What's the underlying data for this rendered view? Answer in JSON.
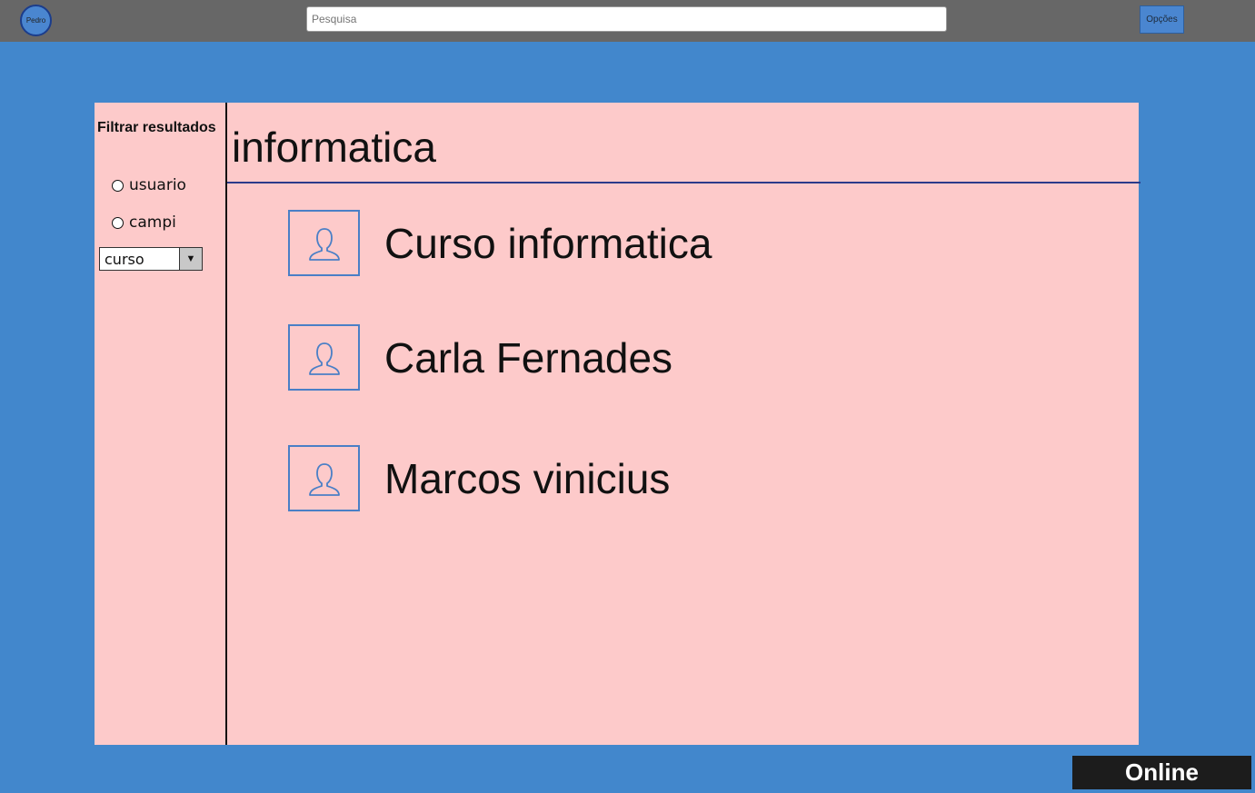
{
  "topbar": {
    "avatar_label": "Pedro",
    "search_placeholder": "Pesquisa",
    "options_label": "Opções"
  },
  "sidebar": {
    "title": "Filtrar resultados",
    "filters": [
      {
        "label": "usuario",
        "checked": false
      },
      {
        "label": "campi",
        "checked": false
      }
    ],
    "select_value": "curso"
  },
  "main": {
    "heading": "informatica",
    "results": [
      {
        "name": "Curso informatica",
        "icon": "user-icon"
      },
      {
        "name": "Carla Fernades",
        "icon": "user-icon"
      },
      {
        "name": "Marcos vinicius",
        "icon": "user-icon"
      }
    ]
  },
  "status": "Online",
  "colors": {
    "background": "#4287cc",
    "topbar": "#676767",
    "panel": "#fdcaca",
    "status_bg": "#1c1c1c"
  }
}
